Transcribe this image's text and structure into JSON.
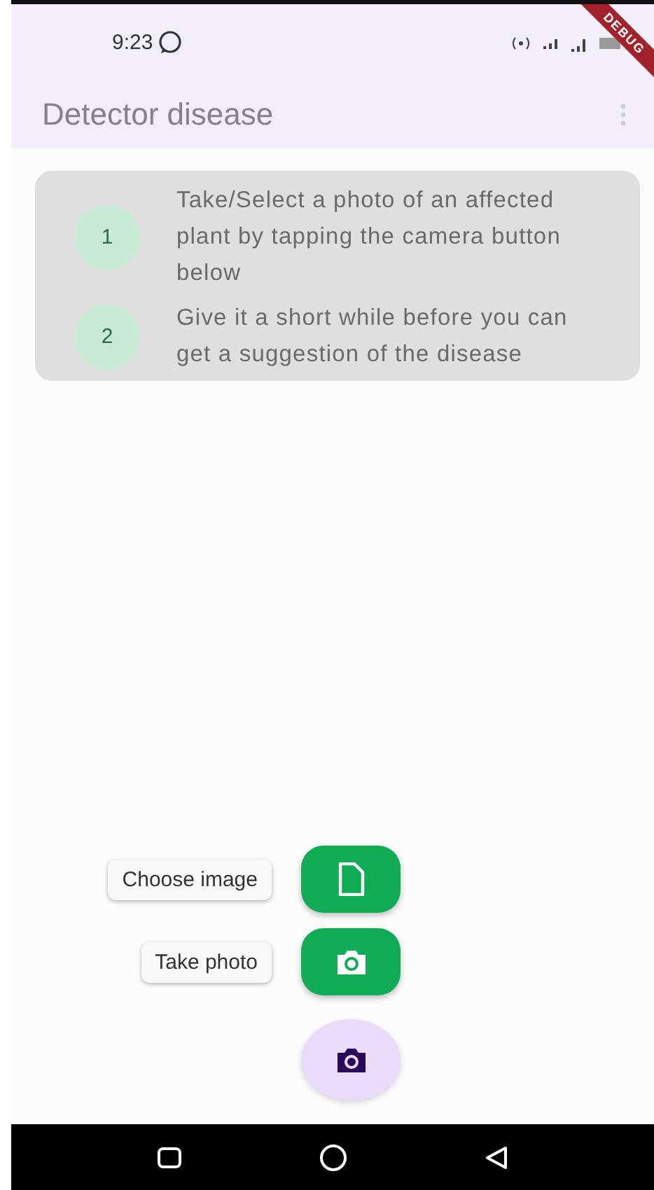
{
  "status_bar": {
    "time": "9:23"
  },
  "debug_banner": {
    "label": "DEBUG"
  },
  "app_bar": {
    "title": "Detector disease"
  },
  "steps": [
    {
      "number": "1",
      "text": "Take/Select a photo of an affected plant by tapping the camera button below"
    },
    {
      "number": "2",
      "text": "Give it a short while before you can get a suggestion of the disease"
    }
  ],
  "fab_actions": [
    {
      "label": "Choose image",
      "kind": "file"
    },
    {
      "label": "Take photo",
      "kind": "camera"
    }
  ],
  "main_fab": {
    "kind": "camera"
  }
}
